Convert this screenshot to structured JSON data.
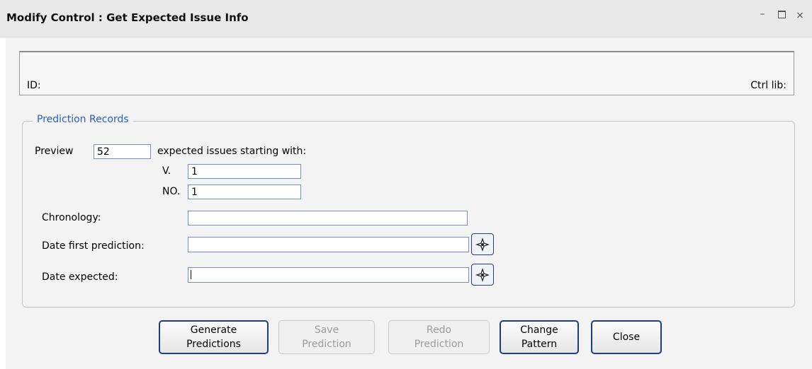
{
  "window": {
    "title": "Modify Control : Get Expected Issue Info",
    "controls": {
      "minimize": "–",
      "maximize": "□",
      "close": "×"
    }
  },
  "header_panel": {
    "id_label": "ID:",
    "ctrl_lib_label": "Ctrl lib:"
  },
  "prediction_records": {
    "legend": "Prediction Records",
    "preview_label": "Preview",
    "preview_value": "52",
    "starting_label": "expected issues starting with:",
    "v_label": "V.",
    "v_value": "1",
    "no_label": "NO.",
    "no_value": "1",
    "chronology_label": "Chronology:",
    "chronology_value": "",
    "date_first_label": "Date first prediction:",
    "date_first_value": "",
    "date_expected_label": "Date expected:",
    "date_expected_value": ""
  },
  "buttons": {
    "generate": {
      "line1": "Generate",
      "line2": "Predictions",
      "enabled": true
    },
    "save": {
      "line1": "Save",
      "line2": "Prediction",
      "enabled": false
    },
    "redo": {
      "line1": "Redo",
      "line2": "Prediction",
      "enabled": false
    },
    "change": {
      "line1": "Change",
      "line2": "Pattern",
      "enabled": true
    },
    "close": {
      "label": "Close",
      "enabled": true
    }
  },
  "icons": {
    "calendar": "calendar-icon"
  },
  "colors": {
    "legend_text": "#2a5cc9",
    "button_border": "#1f3d86",
    "input_border": "#7a8fb4"
  }
}
